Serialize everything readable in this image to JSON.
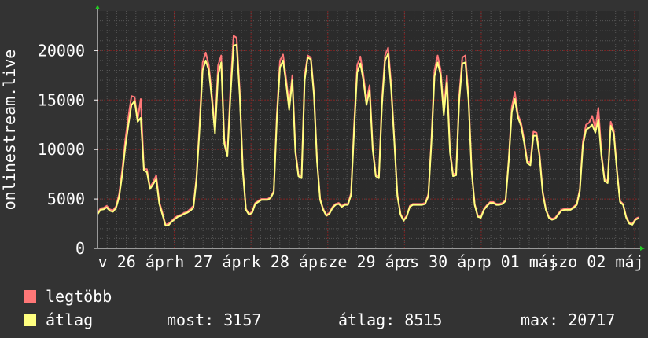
{
  "chart_data": {
    "type": "line",
    "ylabel": "onlinestream.live",
    "ylim": [
      0,
      24000
    ],
    "yticks": [
      0,
      5000,
      10000,
      15000,
      20000
    ],
    "grid": true,
    "x_tick_labels": [
      "v 26 ápr",
      "h 27 ápr",
      "k 28 ápr",
      "sze 29 ápr",
      "cs 30 ápr",
      "p 01 máj",
      "szo 02 máj"
    ],
    "x_tick_at_day": [
      1,
      2,
      3,
      4,
      5,
      6,
      7
    ],
    "x_days": [
      0,
      7.05
    ],
    "series": [
      {
        "name": "legtöbb",
        "color": "#ff7777",
        "values": [
          3550,
          4050,
          4100,
          4300,
          3950,
          3850,
          4250,
          5500,
          8000,
          11000,
          13300,
          15400,
          15300,
          13000,
          15100,
          8000,
          8000,
          6200,
          6700,
          7400,
          4700,
          3600,
          2400,
          2500,
          2800,
          3100,
          3300,
          3400,
          3600,
          3700,
          4000,
          4300,
          7200,
          12500,
          18800,
          19800,
          18500,
          15500,
          12000,
          18500,
          19500,
          11000,
          9500,
          16300,
          21500,
          21300,
          16000,
          8000,
          4000,
          3500,
          3700,
          4600,
          4800,
          5000,
          5000,
          5000,
          5200,
          5800,
          13500,
          19000,
          19600,
          17200,
          14500,
          17500,
          10000,
          7500,
          7300,
          17500,
          19500,
          19300,
          15800,
          9000,
          5000,
          4000,
          3400,
          3600,
          4200,
          4500,
          4600,
          4300,
          4500,
          4500,
          5600,
          12500,
          18500,
          19400,
          17500,
          15000,
          16500,
          10300,
          7500,
          7300,
          15000,
          19500,
          20300,
          16500,
          11000,
          5500,
          3500,
          2900,
          3300,
          4300,
          4500,
          4500,
          4500,
          4500,
          4600,
          5500,
          11000,
          18000,
          19500,
          18000,
          14000,
          17500,
          10000,
          7500,
          7600,
          15500,
          19300,
          19500,
          15500,
          8000,
          4500,
          3300,
          3200,
          4000,
          4400,
          4700,
          4700,
          4500,
          4500,
          4600,
          4900,
          9000,
          14300,
          15800,
          13500,
          12700,
          11000,
          8800,
          8700,
          11800,
          11700,
          9500,
          5800,
          4000,
          3200,
          3000,
          3100,
          3500,
          3900,
          4000,
          4000,
          4000,
          4200,
          4500,
          6000,
          10800,
          12500,
          12700,
          13400,
          12100,
          14200,
          9600,
          7000,
          6800,
          12800,
          11900,
          8000,
          4800,
          4500,
          3200,
          2600,
          2500,
          3000,
          3157
        ]
      },
      {
        "name": "átlag",
        "color": "#ffff80",
        "values": [
          3450,
          3900,
          3950,
          4150,
          3800,
          3700,
          4100,
          5200,
          7500,
          10300,
          12500,
          14500,
          14900,
          12800,
          13200,
          7900,
          7700,
          6000,
          6500,
          7000,
          4500,
          3400,
          2300,
          2350,
          2700,
          2950,
          3200,
          3300,
          3500,
          3600,
          3800,
          4100,
          6900,
          12000,
          18000,
          19000,
          18000,
          15000,
          11600,
          17500,
          18800,
          10600,
          9300,
          15500,
          20500,
          20600,
          15500,
          7800,
          3900,
          3400,
          3600,
          4500,
          4700,
          4900,
          4900,
          4900,
          5100,
          5700,
          13000,
          18300,
          19000,
          16700,
          14000,
          17000,
          9700,
          7300,
          7100,
          17000,
          19300,
          19100,
          15500,
          8800,
          4900,
          3900,
          3300,
          3500,
          4100,
          4400,
          4500,
          4200,
          4400,
          4400,
          5400,
          12000,
          17800,
          18700,
          17000,
          14500,
          16000,
          10000,
          7300,
          7100,
          14500,
          19000,
          19700,
          16000,
          10800,
          5300,
          3400,
          2800,
          3200,
          4200,
          4400,
          4400,
          4400,
          4400,
          4500,
          5300,
          10700,
          17400,
          18800,
          17500,
          13500,
          16800,
          9700,
          7300,
          7400,
          15000,
          18700,
          18800,
          15000,
          7800,
          4400,
          3200,
          3100,
          3900,
          4300,
          4600,
          4600,
          4400,
          4400,
          4500,
          4800,
          8800,
          13800,
          15100,
          13200,
          12400,
          10700,
          8600,
          8400,
          11400,
          11400,
          9200,
          5600,
          3900,
          3100,
          2900,
          3000,
          3400,
          3800,
          3900,
          3900,
          3900,
          4100,
          4400,
          5800,
          10400,
          12000,
          12200,
          12500,
          11700,
          13000,
          9300,
          6800,
          6600,
          12400,
          11600,
          7800,
          4700,
          4400,
          3100,
          2500,
          2400,
          2900,
          3050
        ]
      }
    ],
    "stats": {
      "current": "3157",
      "average": "8515",
      "max": "20717"
    }
  },
  "legend": {
    "items": [
      {
        "label": "legtöbb",
        "color": "#ff7777"
      },
      {
        "label": "átlag",
        "color": "#ffff80"
      }
    ],
    "stats": [
      {
        "label": "most:",
        "value": "3157"
      },
      {
        "label": "átlag:",
        "value": "8515"
      },
      {
        "label": "max:",
        "value": "20717"
      }
    ]
  }
}
